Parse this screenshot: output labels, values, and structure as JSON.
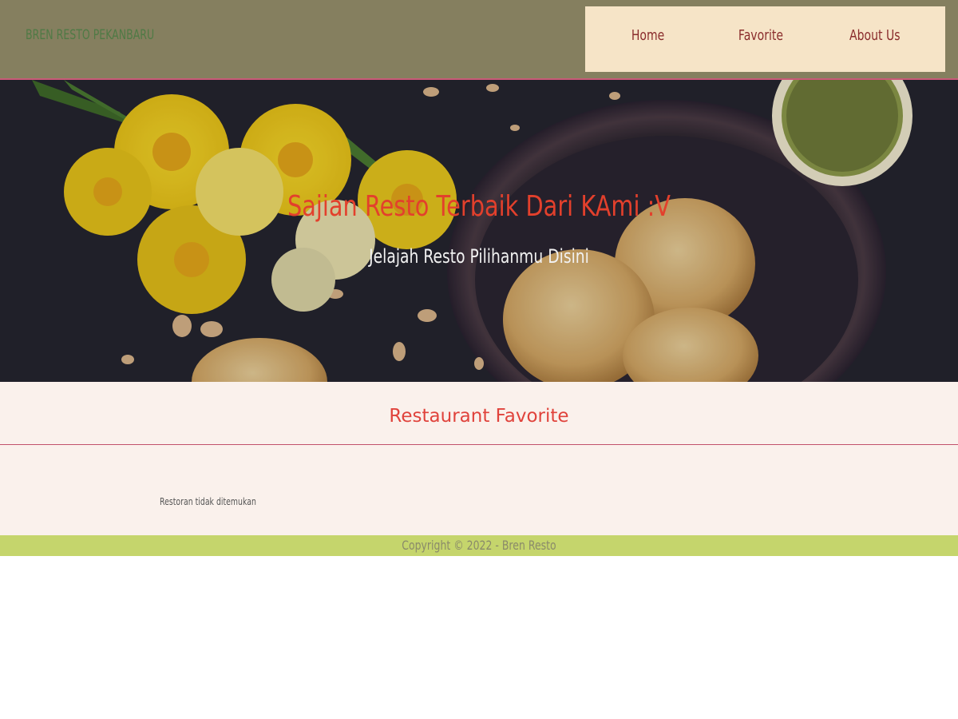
{
  "header": {
    "brand": "BREN RESTO PEKANBARU",
    "nav": [
      {
        "label": "Home"
      },
      {
        "label": "Favorite"
      },
      {
        "label": "About Us"
      }
    ]
  },
  "hero": {
    "title": "Sajian Resto Terbaik Dari KAmi :V",
    "subtitle": "Jelajah Resto Pilihanmu Disini"
  },
  "main": {
    "section_title": "Restaurant Favorite",
    "empty_message": "Restoran tidak ditemukan"
  },
  "footer": {
    "text": "Copyright © 2022 - Bren Resto"
  },
  "colors": {
    "header_bg": "#857f5f",
    "nav_bg": "#f6e4c7",
    "nav_text": "#8a2c2c",
    "brand_text": "#4f7a45",
    "hero_title": "#e3402c",
    "section_title": "#e0433c",
    "content_bg": "#faf1ec",
    "footer_bg": "#c5d56c"
  }
}
